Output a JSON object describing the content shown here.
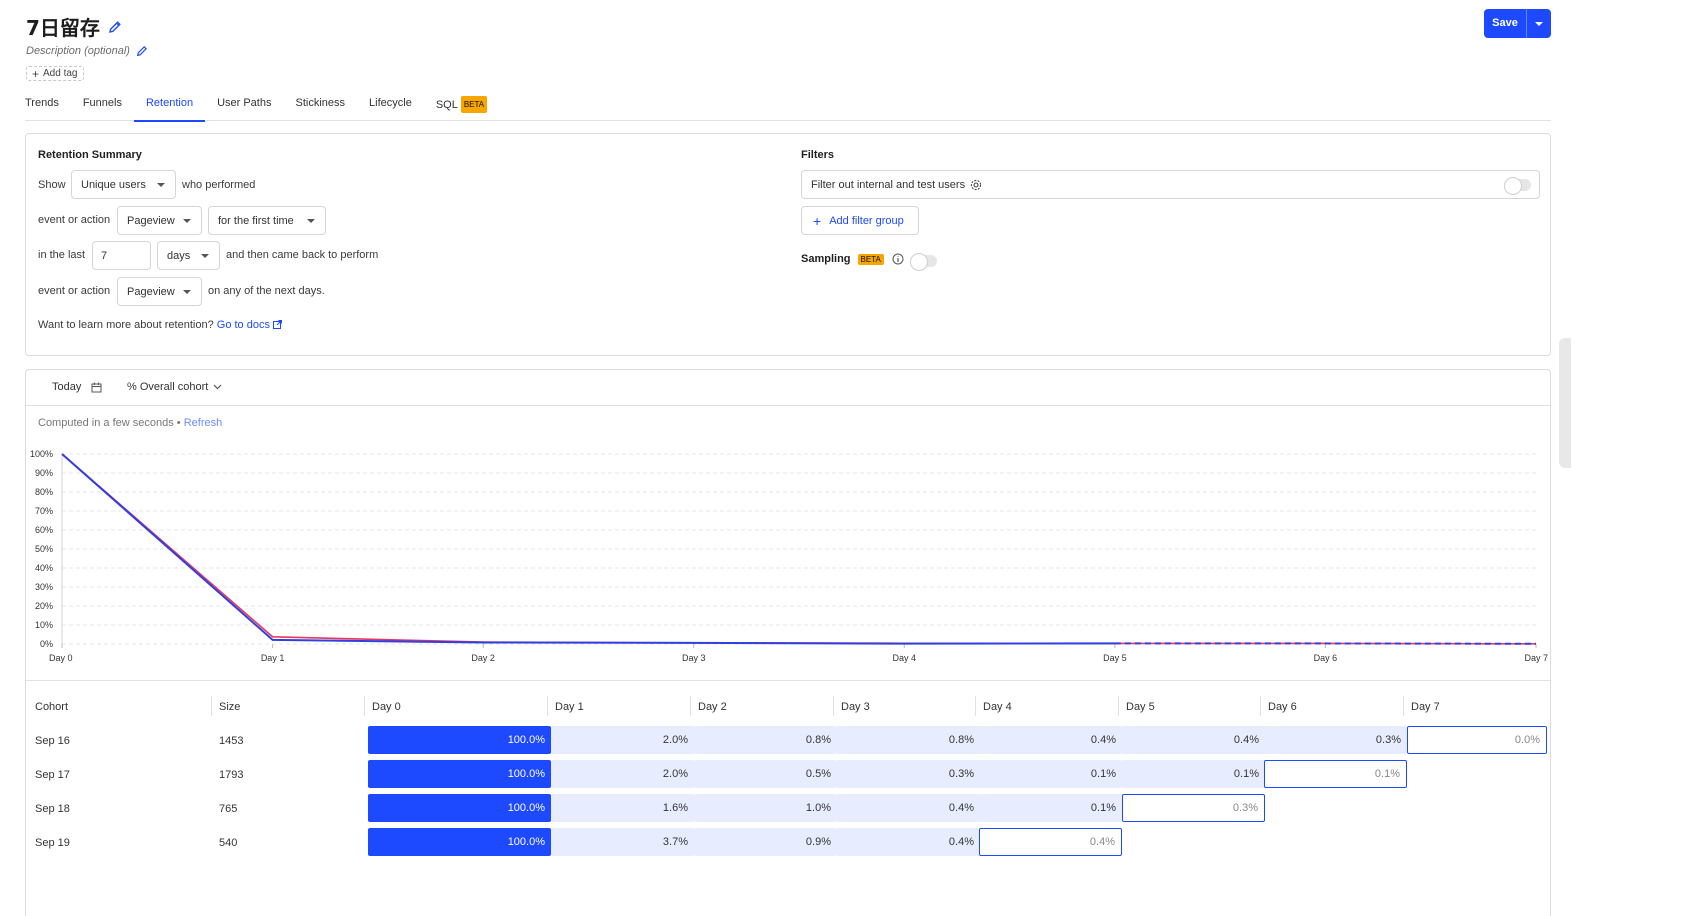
{
  "insight": {
    "title": "7日留存",
    "description_placeholder": "Description (optional)",
    "add_tag_label": "Add tag",
    "save_label": "Save"
  },
  "tabs": [
    {
      "label": "Trends"
    },
    {
      "label": "Funnels"
    },
    {
      "label": "Retention",
      "active": true
    },
    {
      "label": "User Paths"
    },
    {
      "label": "Stickiness"
    },
    {
      "label": "Lifecycle"
    },
    {
      "label": "SQL",
      "badge": "BETA"
    }
  ],
  "retention_summary": {
    "title": "Retention Summary",
    "show_label": "Show",
    "show_value": "Unique users",
    "who_performed": "who performed",
    "event_label_1": "event or action",
    "event_value_1": "Pageview",
    "first_time_value": "for the first time",
    "in_the_last_label": "in the last",
    "period_value": "7",
    "period_unit": "days",
    "came_back_label": "and then came back to perform",
    "event_label_2": "event or action",
    "event_value_2": "Pageview",
    "next_days_label": "on any of the next days.",
    "learn_more": "Want to learn more about retention?",
    "docs_link": "Go to docs"
  },
  "filters": {
    "title": "Filters",
    "test_users_label": "Filter out internal and test users",
    "add_filter_group": "Add filter group",
    "sampling_label": "Sampling",
    "sampling_badge": "BETA"
  },
  "results": {
    "date_label": "Today",
    "cohort_mode": "% Overall cohort",
    "computed_text": "Computed in a few seconds •",
    "refresh_label": "Refresh"
  },
  "colors": {
    "accent": "#1d4aff",
    "cohort_fill_strong": "#1d4aff",
    "cohort_fill_light": "#e8ecff",
    "series_red": "#e8365d",
    "series_blue": "#3040e0"
  },
  "chart_data": {
    "type": "line",
    "categories": [
      "Day 0",
      "Day 1",
      "Day 2",
      "Day 3",
      "Day 4",
      "Day 5",
      "Day 6",
      "Day 7"
    ],
    "y_ticks": [
      "0%",
      "10%",
      "20%",
      "30%",
      "40%",
      "50%",
      "60%",
      "70%",
      "80%",
      "90%",
      "100%"
    ],
    "ylim": [
      0,
      100
    ],
    "grid": true,
    "series": [
      {
        "color": "#e8365d",
        "values": [
          100,
          3.8,
          1.0,
          0.6,
          0.4,
          0.3,
          0.3,
          0.1
        ]
      },
      {
        "color": "#3040e0",
        "values": [
          100,
          2.2,
          0.8,
          0.6,
          0.2,
          0.3,
          0.3,
          0.1
        ],
        "dashed_from_index": 5
      }
    ]
  },
  "table": {
    "headers": [
      "Cohort",
      "Size",
      "Day 0",
      "Day 1",
      "Day 2",
      "Day 3",
      "Day 4",
      "Day 5",
      "Day 6",
      "Day 7"
    ],
    "rows": [
      {
        "cohort": "Sep 16",
        "size": "1453",
        "cells": [
          "100.0%",
          "2.0%",
          "0.8%",
          "0.8%",
          "0.4%",
          "0.4%",
          "0.3%",
          "0.0%"
        ]
      },
      {
        "cohort": "Sep 17",
        "size": "1793",
        "cells": [
          "100.0%",
          "2.0%",
          "0.5%",
          "0.3%",
          "0.1%",
          "0.1%",
          "0.1%"
        ]
      },
      {
        "cohort": "Sep 18",
        "size": "765",
        "cells": [
          "100.0%",
          "1.6%",
          "1.0%",
          "0.4%",
          "0.1%",
          "0.3%"
        ]
      },
      {
        "cohort": "Sep 19",
        "size": "540",
        "cells": [
          "100.0%",
          "3.7%",
          "0.9%",
          "0.4%",
          "0.4%"
        ]
      }
    ]
  }
}
